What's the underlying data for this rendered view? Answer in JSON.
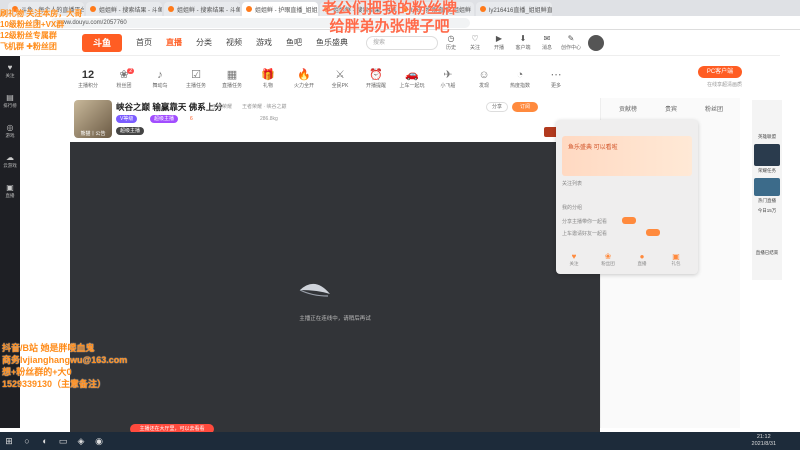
{
  "browser": {
    "tabs": [
      {
        "title": "斗鱼 - 每个人的直播平台"
      },
      {
        "title": "姐姐鲜 - 搜索结果 - 斗鱼直播"
      },
      {
        "title": "姐姐鲜 - 搜索结果 - 斗鱼直播"
      },
      {
        "title": "姐姐鲜 - 护眼直播_姐姐鲜"
      },
      {
        "title": "姐姐鲜 - 搜索结果 - 斗鱼直播"
      },
      {
        "title": "lyt3 - 护眼直播_姐姐鲜"
      },
      {
        "title": "ly216416直播_姐姐鲜直播"
      }
    ],
    "url": "www.douyu.com/2057760"
  },
  "header": {
    "logo": "斗鱼",
    "nav": [
      "首页",
      "直播",
      "分类",
      "视频",
      "游戏",
      "鱼吧",
      "鱼乐盛典"
    ],
    "search_placeholder": "搜索",
    "icons": [
      {
        "label": "历史",
        "glyph": "◷"
      },
      {
        "label": "关注",
        "glyph": "♡"
      },
      {
        "label": "开播",
        "glyph": "▶"
      },
      {
        "label": "客户端",
        "glyph": "⬇"
      },
      {
        "label": "消息",
        "glyph": "✉"
      },
      {
        "label": "创作中心",
        "glyph": "✎"
      }
    ]
  },
  "sidebar": {
    "items": [
      {
        "label": "关注",
        "glyph": "♥"
      },
      {
        "label": "排行榜",
        "glyph": "▤"
      },
      {
        "label": "游戏",
        "glyph": "◎"
      },
      {
        "label": "云游戏",
        "glyph": "☁"
      },
      {
        "label": "直播",
        "glyph": "▣"
      }
    ]
  },
  "toolbar": {
    "level": "12",
    "items": [
      {
        "label": "主播积分",
        "glyph": "⚑",
        "badge": ""
      },
      {
        "label": "粉丝团",
        "glyph": "❀",
        "badge": "2"
      },
      {
        "label": "舞动鸟",
        "glyph": "♪",
        "badge": ""
      },
      {
        "label": "主播任务",
        "glyph": "☑",
        "badge": ""
      },
      {
        "label": "直播任务",
        "glyph": "▦",
        "badge": ""
      },
      {
        "label": "礼物",
        "glyph": "🎁",
        "badge": ""
      },
      {
        "label": "火力全开",
        "glyph": "🔥",
        "badge": ""
      },
      {
        "label": "全民PK",
        "glyph": "⚔",
        "badge": ""
      },
      {
        "label": "开播提醒",
        "glyph": "⏰",
        "badge": ""
      },
      {
        "label": "上车一起玩",
        "glyph": "🚗",
        "badge": ""
      },
      {
        "label": "小飞船",
        "glyph": "✈",
        "badge": ""
      },
      {
        "label": "发现",
        "glyph": "☺",
        "badge": ""
      },
      {
        "label": "热度指数",
        "glyph": "◔",
        "badge": ""
      },
      {
        "label": "更多",
        "glyph": "⋯",
        "badge": ""
      }
    ],
    "pc_button": "PC客户端",
    "pc_sub": "在线享超清画质"
  },
  "stream": {
    "title": "峡谷之巅 输赢靠天 佛系上分",
    "category": "王者荣耀",
    "meta": "王者荣耀 · 峡谷之巅",
    "avatar_label": "熊猫丨公告",
    "badges": [
      "V等级",
      "超级主播",
      "超级主播"
    ],
    "hot": "6",
    "followers": "286.8kg",
    "subscribe": "订阅",
    "share": "分享",
    "gift": "送礼物 2"
  },
  "video": {
    "message": "主播正在连线中，请稍后再试",
    "bottom_pill": "主播还在大厅里，可以去看看"
  },
  "popup": {
    "banner_title": "鱼乐盛典 可以看啦",
    "rows": [
      "关注列表",
      "我的分组",
      "分享主播带你一起看",
      "上车邀请好友一起看"
    ],
    "mini": [
      {
        "label": "关注",
        "glyph": "♥"
      },
      {
        "label": "粉丝团",
        "glyph": "❀"
      },
      {
        "label": "直播",
        "glyph": "●"
      },
      {
        "label": "礼包",
        "glyph": "▣"
      }
    ]
  },
  "right_panel": {
    "tabs": [
      "贡献榜",
      "贵宾",
      "粉丝团"
    ]
  },
  "ad_rail": {
    "labels": [
      "英雄联盟",
      "荣耀任务",
      "热门直播",
      "今日15万",
      "直播已结束"
    ]
  },
  "overlay": {
    "top_left": [
      "刷礼物 关注本房，大哥",
      "10级粉丝团+VX群",
      "12级粉丝专属群",
      "飞机群 ✚粉丝团"
    ],
    "top_center": [
      "老公们把我的粉丝牌",
      "给胖弟办张牌子吧"
    ],
    "bottom_left": [
      "抖音/B站 她是胖喽血鬼",
      "商务lvjianghangwu@163.com",
      "想+粉丝群的+大0",
      "1529339130（主意备注）"
    ]
  },
  "taskbar": {
    "icons": [
      {
        "name": "start",
        "glyph": "⊞"
      },
      {
        "name": "search",
        "glyph": "○"
      },
      {
        "name": "edge",
        "glyph": "◐"
      },
      {
        "name": "explorer",
        "glyph": "▭"
      },
      {
        "name": "app",
        "glyph": "◈"
      },
      {
        "name": "obs",
        "glyph": "◉"
      }
    ],
    "time": "21:12",
    "date": "2021/8/31"
  },
  "colors": {
    "brand": "#ff5d23",
    "sidebar": "#1e1f24",
    "video": "#323438",
    "taskbar": "#1d2b3a",
    "overlay_text": "#ff8c1a"
  }
}
